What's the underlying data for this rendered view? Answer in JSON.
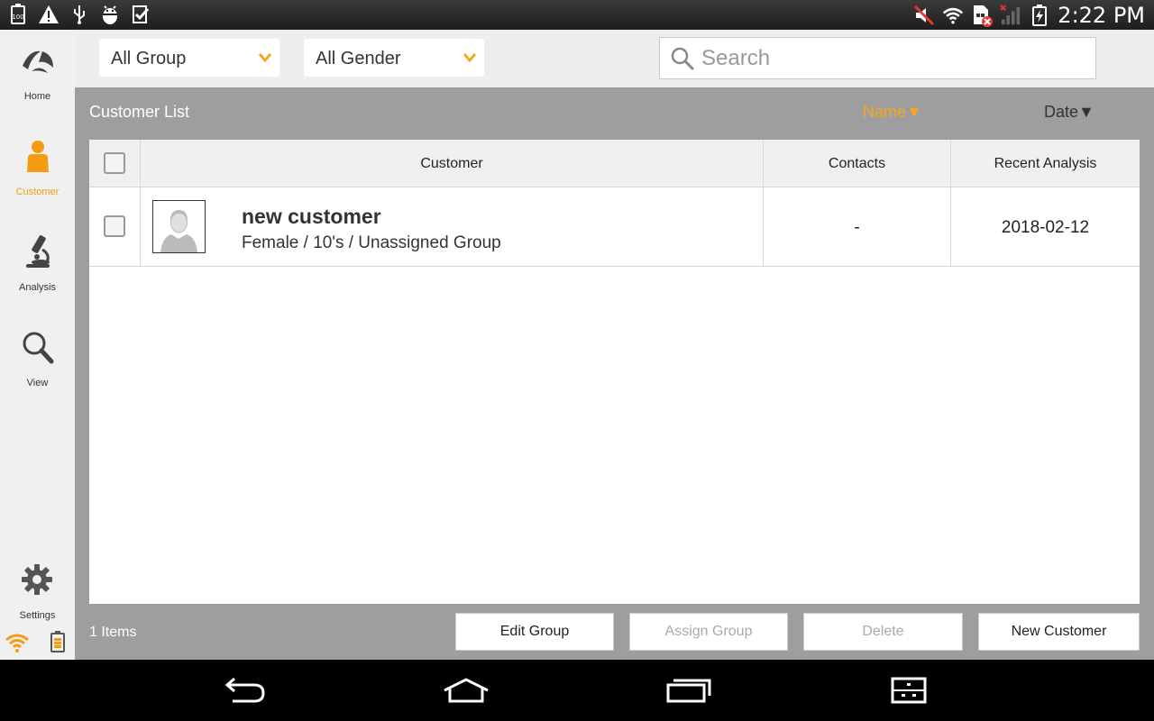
{
  "status_bar": {
    "time": "2:22 PM",
    "left_icons": [
      "battery-100-icon",
      "warning-icon",
      "usb-icon",
      "android-debug-icon",
      "task-check-icon"
    ],
    "right_icons": [
      "mute-icon",
      "wifi-icon",
      "sim-error-icon",
      "signal-icon",
      "battery-charging-icon"
    ]
  },
  "sidebar": {
    "items": [
      {
        "label": "Home",
        "icon": "home-logo-icon",
        "active": false
      },
      {
        "label": "Customer",
        "icon": "person-icon",
        "active": true
      },
      {
        "label": "Analysis",
        "icon": "microscope-icon",
        "active": false
      },
      {
        "label": "View",
        "icon": "magnifier-icon",
        "active": false
      }
    ],
    "settings_label": "Settings"
  },
  "filters": {
    "group_value": "All Group",
    "gender_value": "All Gender",
    "search_placeholder": "Search"
  },
  "list": {
    "title": "Customer List",
    "sort_name": "Name▼",
    "sort_date": "Date▼",
    "columns": [
      "Customer",
      "Contacts",
      "Recent Analysis"
    ],
    "rows": [
      {
        "name": "new customer",
        "details": "Female / 10's / Unassigned Group",
        "contacts": "-",
        "recent_analysis": "2018-02-12"
      }
    ],
    "items_count": "1 Items"
  },
  "actions": {
    "edit_group": "Edit Group",
    "assign_group": "Assign Group",
    "delete": "Delete",
    "new_customer": "New Customer"
  },
  "colors": {
    "accent": "#f5a623",
    "sidebar_bg": "#f0f0f0",
    "main_bg": "#9e9e9e"
  }
}
